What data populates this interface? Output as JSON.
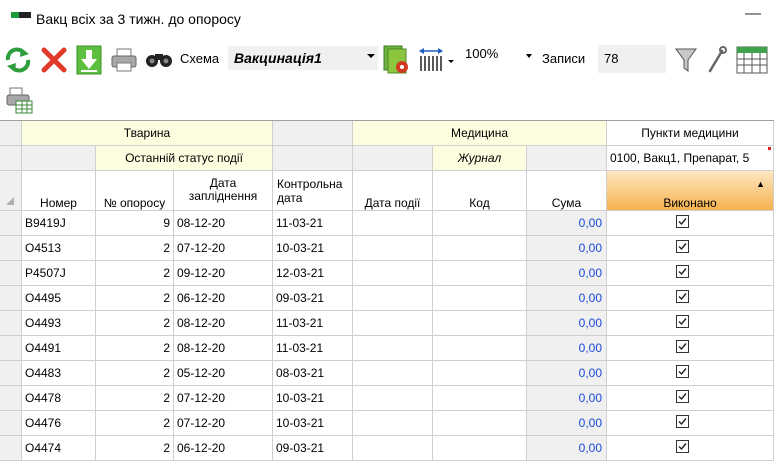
{
  "window": {
    "title": "Вакц всіх за 3 тижн. до опоросу",
    "minimize_label": "—"
  },
  "toolbar": {
    "scheme_label": "Схема",
    "scheme_value": "Вакцинація1",
    "zoom_value": "100%",
    "records_label": "Записи",
    "records_value": "78",
    "icons": [
      "refresh-icon",
      "delete-icon",
      "download-icon",
      "print-icon",
      "find-icon",
      "scheme-settings-icon",
      "column-width-icon",
      "filter-icon",
      "settings-wrench-icon",
      "calendar-icon",
      "print-grid-icon"
    ]
  },
  "grid": {
    "groups": {
      "animal": "Тварина",
      "medicine": "Медицина",
      "points": "Пункти медицини"
    },
    "subgroups": {
      "last_status": "Останній статус події",
      "journal": "Журнал",
      "points_value": "0100, Вакц1, Препарат, 5"
    },
    "columns": [
      "Номер",
      "№ опоросу",
      "Дата запліднення",
      "Контрольна дата",
      "Дата події",
      "Код",
      "Сума",
      "Виконано"
    ],
    "sort_indicator": "▲",
    "rows": [
      {
        "number": "B9419J",
        "farrowing": "9",
        "mating_date": "08-12-20",
        "control_date": "11-03-21",
        "event_date": "",
        "code": "",
        "sum": "0,00",
        "done": true
      },
      {
        "number": "O4513",
        "farrowing": "2",
        "mating_date": "07-12-20",
        "control_date": "10-03-21",
        "event_date": "",
        "code": "",
        "sum": "0,00",
        "done": true
      },
      {
        "number": "P4507J",
        "farrowing": "2",
        "mating_date": "09-12-20",
        "control_date": "12-03-21",
        "event_date": "",
        "code": "",
        "sum": "0,00",
        "done": true
      },
      {
        "number": "O4495",
        "farrowing": "2",
        "mating_date": "06-12-20",
        "control_date": "09-03-21",
        "event_date": "",
        "code": "",
        "sum": "0,00",
        "done": true
      },
      {
        "number": "O4493",
        "farrowing": "2",
        "mating_date": "08-12-20",
        "control_date": "11-03-21",
        "event_date": "",
        "code": "",
        "sum": "0,00",
        "done": true
      },
      {
        "number": "O4491",
        "farrowing": "2",
        "mating_date": "08-12-20",
        "control_date": "11-03-21",
        "event_date": "",
        "code": "",
        "sum": "0,00",
        "done": true
      },
      {
        "number": "O4483",
        "farrowing": "2",
        "mating_date": "05-12-20",
        "control_date": "08-03-21",
        "event_date": "",
        "code": "",
        "sum": "0,00",
        "done": true
      },
      {
        "number": "O4478",
        "farrowing": "2",
        "mating_date": "07-12-20",
        "control_date": "10-03-21",
        "event_date": "",
        "code": "",
        "sum": "0,00",
        "done": true
      },
      {
        "number": "O4476",
        "farrowing": "2",
        "mating_date": "07-12-20",
        "control_date": "10-03-21",
        "event_date": "",
        "code": "",
        "sum": "0,00",
        "done": true
      },
      {
        "number": "O4474",
        "farrowing": "2",
        "mating_date": "06-12-20",
        "control_date": "09-03-21",
        "event_date": "",
        "code": "",
        "sum": "0,00",
        "done": true
      }
    ]
  }
}
